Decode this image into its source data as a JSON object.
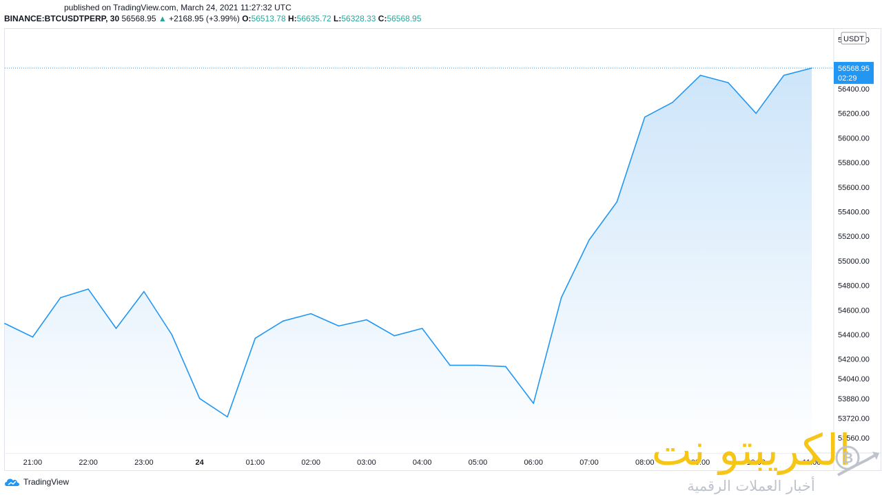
{
  "publish_note": "published on TradingView.com, March 24, 2021 11:27:32 UTC",
  "header": {
    "symbol": "BINANCE:BTCUSDTPERP, 30",
    "last": "56568.95",
    "change_arrow": "▲",
    "change": "+2168.95 (+3.99%)",
    "o_label": "O:",
    "o": "56513.78",
    "h_label": "H:",
    "h": "56635.72",
    "l_label": "L:",
    "l": "56328.33",
    "c_label": "C:",
    "c": "56568.95"
  },
  "price_axis": {
    "currency": "USDT",
    "tick_labels": [
      "56800.00",
      "56600.00",
      "56400.00",
      "56200.00",
      "56000.00",
      "55800.00",
      "55600.00",
      "55400.00",
      "55200.00",
      "55000.00",
      "54800.00",
      "54600.00",
      "54400.00",
      "54200.00",
      "54040.00",
      "53880.00",
      "53720.00",
      "53560.00"
    ],
    "last_price_label": "56568.95",
    "countdown": "02:29"
  },
  "time_axis": {
    "labels": [
      "21:00",
      "22:00",
      "23:00",
      "24",
      "01:00",
      "02:00",
      "03:00",
      "04:00",
      "05:00",
      "06:00",
      "07:00",
      "08:00",
      "09:00",
      "10:00",
      "11:00"
    ]
  },
  "watermark": {
    "arabic_title": "الكريبتو نت",
    "arabic_subtitle": "أخبار العملات الرقمية"
  },
  "footer": {
    "brand": "TradingView"
  },
  "colors": {
    "line": "#2196f3",
    "area_top": "#cde5fa",
    "area_bottom": "#ffffff",
    "price_tag": "#2196f3",
    "up": "#26a69a",
    "axis_text": "#131722",
    "watermark_gold": "#f5c518",
    "watermark_grey": "#bfc3cc"
  },
  "chart_data": {
    "type": "area",
    "x": [
      "20:30",
      "21:00",
      "21:30",
      "22:00",
      "22:30",
      "23:00",
      "23:30",
      "00:00",
      "00:30",
      "01:00",
      "01:30",
      "02:00",
      "02:30",
      "03:00",
      "03:30",
      "04:00",
      "04:30",
      "05:00",
      "05:30",
      "06:00",
      "06:30",
      "07:00",
      "07:30",
      "08:00",
      "08:30",
      "09:00",
      "09:30",
      "10:00",
      "10:30",
      "11:00"
    ],
    "values": [
      54490,
      54380,
      54700,
      54770,
      54450,
      54750,
      54400,
      53880,
      53730,
      54370,
      54510,
      54570,
      54470,
      54520,
      54390,
      54450,
      54150,
      54150,
      54140,
      53840,
      54700,
      55170,
      55480,
      56170,
      56290,
      56510,
      56450,
      56200,
      56510,
      56569
    ],
    "ylim": [
      53520,
      56770
    ],
    "grid": false,
    "last_price": 56568.95,
    "currency": "USDT"
  }
}
